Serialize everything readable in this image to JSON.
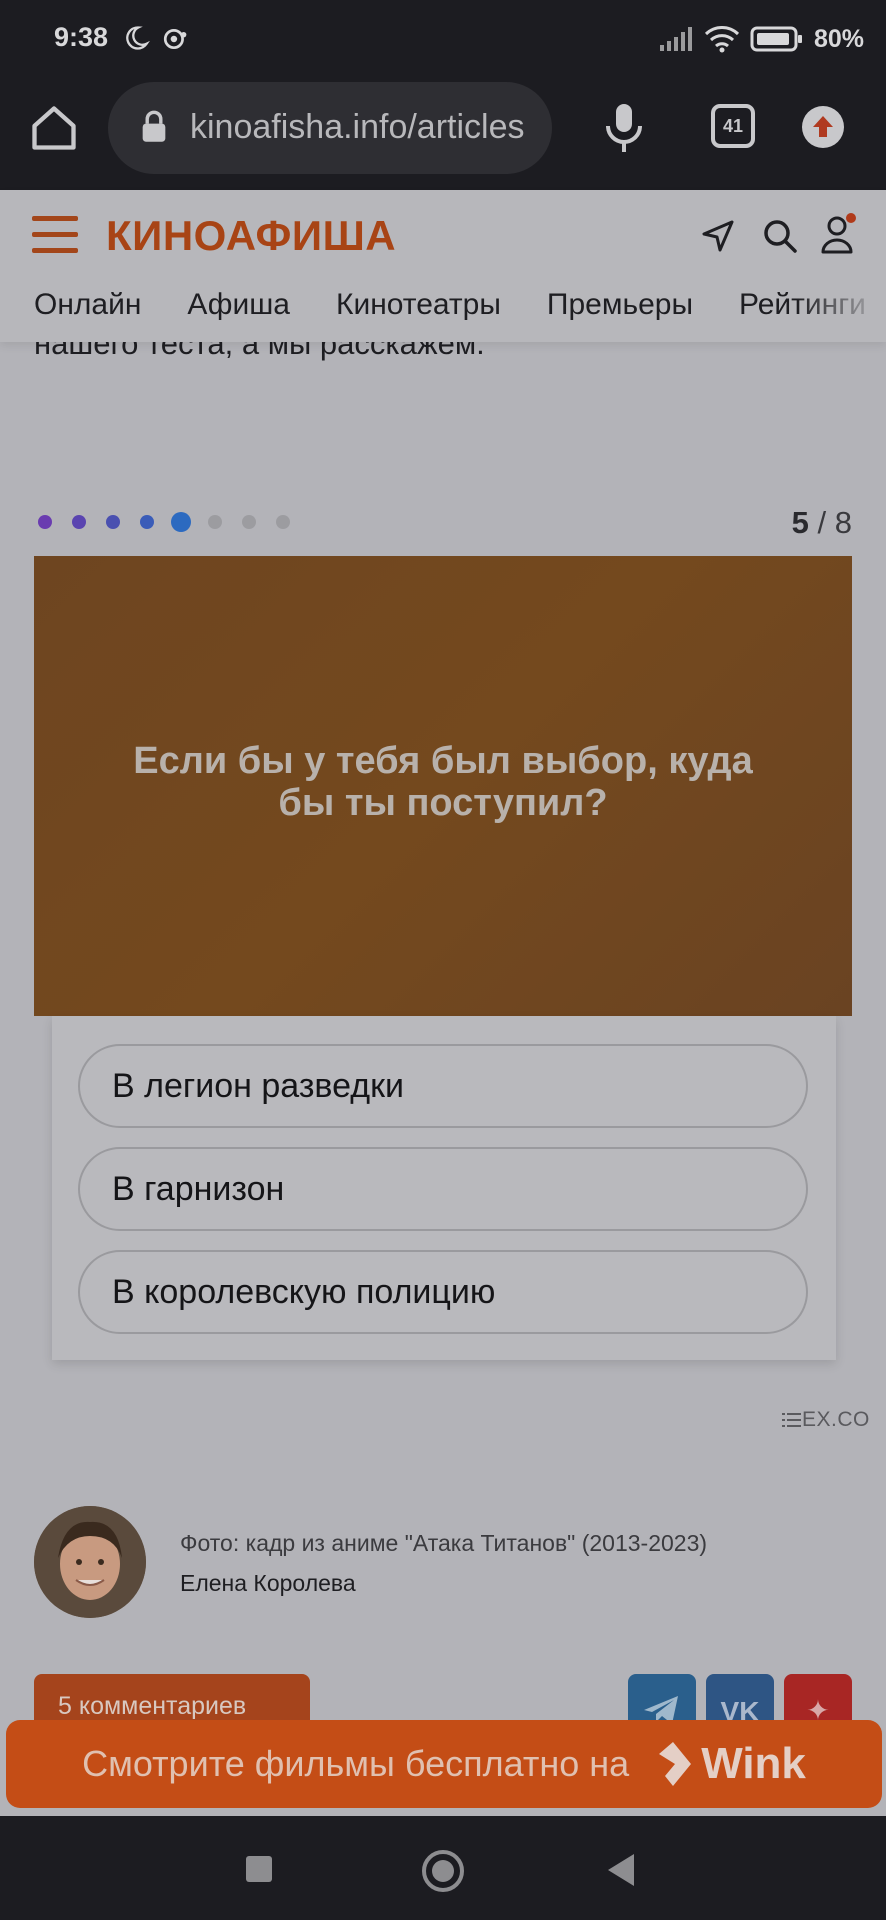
{
  "status_bar": {
    "time": "9:38",
    "battery": "80%",
    "icons": [
      "moon-icon",
      "dnd-icon",
      "signal-icon",
      "wifi-icon",
      "battery-icon"
    ]
  },
  "browser": {
    "url": "kinoafisha.info/articles",
    "tab_count": "41",
    "icons": [
      "home-icon",
      "lock-icon",
      "mic-icon",
      "tabs-icon",
      "update-icon"
    ]
  },
  "header": {
    "logo": "КИНОАФИША",
    "nav": [
      "Онлайн",
      "Афиша",
      "Кинотеатры",
      "Премьеры",
      "Рейтинги"
    ],
    "accent_color": "#a84415"
  },
  "article": {
    "text_fragment": "нашего теста, а мы расскажем."
  },
  "quiz": {
    "current": "5",
    "total": "8",
    "counter_separator": " / ",
    "question": "Если бы у тебя был выбор, куда бы ты поступил?",
    "answers": [
      "В легион разведки",
      "В гарнизон",
      "В королевскую полицию"
    ],
    "dot_colors": [
      "#6a3cb0",
      "#5a44b0",
      "#4a50b0",
      "#3a5cb8",
      "#2c6ac0",
      "#9c9ca0",
      "#9c9ca0",
      "#9c9ca0"
    ],
    "provider": "EX.CO"
  },
  "credit": {
    "photo_caption": "Фото: кадр из аниме \"Атака Титанов\" (2013-2023)",
    "author": "Елена Королева"
  },
  "actions": {
    "comments": "5 комментариев",
    "vk_label": "VK"
  },
  "banner": {
    "text": "Смотрите фильмы бесплатно на",
    "brand": "Wink"
  }
}
